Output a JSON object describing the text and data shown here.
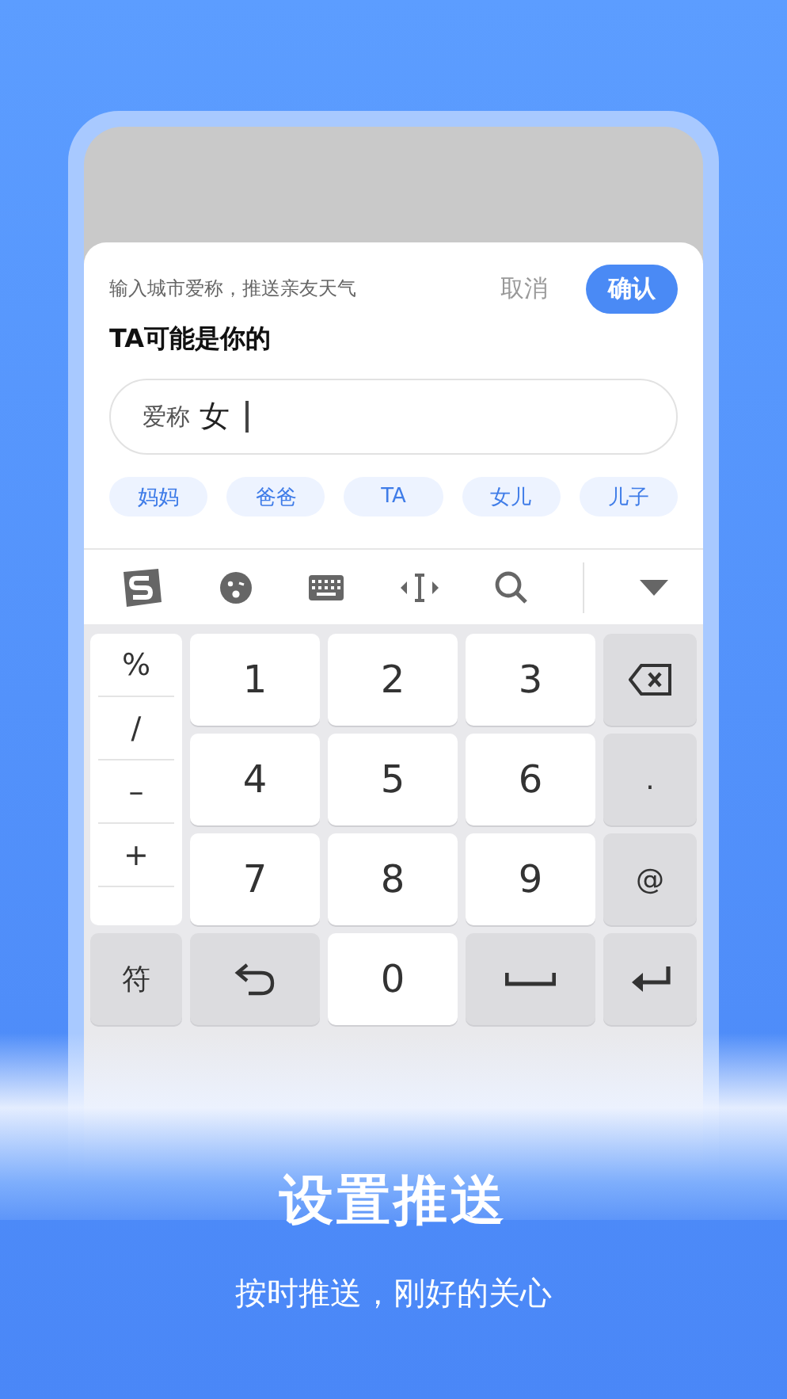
{
  "sheet": {
    "hint": "输入城市爱称，推送亲友天气",
    "cancel": "取消",
    "confirm": "确认",
    "title": "TA可能是你的"
  },
  "field": {
    "label": "爱称",
    "value": "女"
  },
  "chips": [
    "妈妈",
    "爸爸",
    "TA",
    "女儿",
    "儿子"
  ],
  "keyboard": {
    "symbols": [
      "%",
      "/",
      "–",
      "+"
    ],
    "keys": [
      {
        "kind": "digit",
        "label": "1"
      },
      {
        "kind": "digit",
        "label": "2"
      },
      {
        "kind": "digit",
        "label": "3"
      },
      {
        "kind": "backspace"
      },
      {
        "kind": "digit",
        "label": "4"
      },
      {
        "kind": "digit",
        "label": "5"
      },
      {
        "kind": "digit",
        "label": "6"
      },
      {
        "kind": "func",
        "label": "."
      },
      {
        "kind": "digit",
        "label": "7"
      },
      {
        "kind": "digit",
        "label": "8"
      },
      {
        "kind": "digit",
        "label": "9"
      },
      {
        "kind": "func",
        "label": "@"
      },
      {
        "kind": "func",
        "label": "符"
      },
      {
        "kind": "undo"
      },
      {
        "kind": "digit",
        "label": "0"
      },
      {
        "kind": "space"
      },
      {
        "kind": "enter"
      }
    ]
  },
  "caption": {
    "title": "设置推送",
    "subtitle": "按时推送，刚好的关心"
  }
}
